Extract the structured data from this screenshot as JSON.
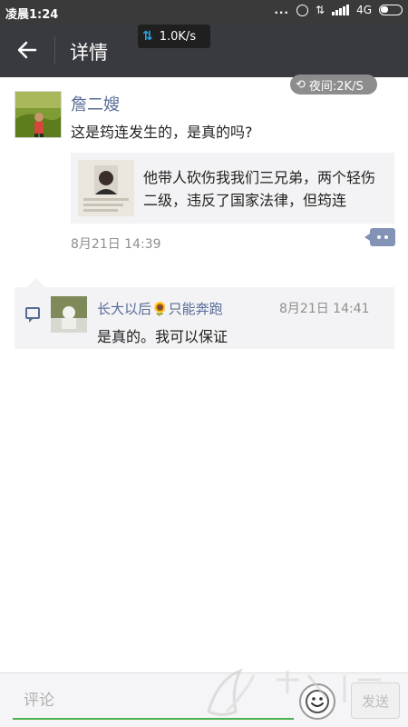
{
  "status_bar": {
    "time": "凌晨1:24",
    "more": "...",
    "network": "4G"
  },
  "header": {
    "title": "详情"
  },
  "overlay": {
    "speed": "1.0K/s",
    "night": "夜间:2K/S"
  },
  "post": {
    "author": "詹二嫂",
    "text": "这是筠连发生的，是真的吗?",
    "shared_text": "他带人砍伤我我们三兄弟，两个轻伤二级，违反了国家法律，但筠连",
    "time": "8月21日 14:39"
  },
  "comment": {
    "author": "长大以后🌻只能奔跑",
    "time": "8月21日 14:41",
    "text": "是真的。我可以保证"
  },
  "input_bar": {
    "placeholder": "评论",
    "send_label": "发送"
  },
  "colors": {
    "title_bar": "#393a3f",
    "link_blue": "#576b95",
    "input_focus": "#4caf50"
  }
}
